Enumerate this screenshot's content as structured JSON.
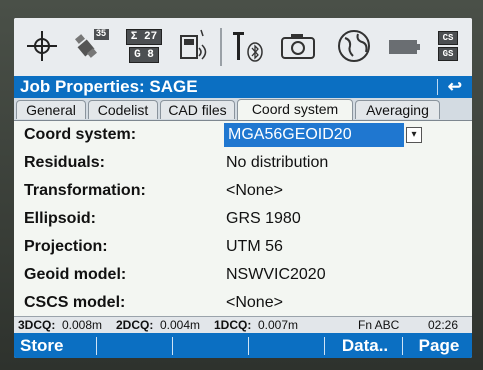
{
  "status": {
    "sat_counts": [
      "Σ 27",
      "G 8"
    ],
    "sat_badge": "35",
    "storage_top": "CS",
    "storage_bottom": "GS"
  },
  "title": "Job Properties: SAGE",
  "back_symbol": "↩",
  "tabs": [
    {
      "label": "General"
    },
    {
      "label": "Codelist"
    },
    {
      "label": "CAD files"
    },
    {
      "label": "Coord system"
    },
    {
      "label": "Averaging"
    }
  ],
  "fields": [
    {
      "label": "Coord system:",
      "value": "MGA56GEOID20"
    },
    {
      "label": "Residuals:",
      "value": "No distribution"
    },
    {
      "label": "Transformation:",
      "value": "<None>"
    },
    {
      "label": "Ellipsoid:",
      "value": "GRS 1980"
    },
    {
      "label": "Projection:",
      "value": "UTM 56"
    },
    {
      "label": "Geoid model:",
      "value": "NSWVIC2020"
    },
    {
      "label": "CSCS model:",
      "value": "<None>"
    }
  ],
  "info": {
    "q3d_label": "3DCQ:",
    "q3d_value": "0.008m",
    "q2d_label": "2DCQ:",
    "q2d_value": "0.004m",
    "q1d_label": "1DCQ:",
    "q1d_value": "0.007m",
    "mode": "Fn ABC",
    "time": "02:26"
  },
  "softkeys": {
    "store": "Store",
    "data": "Data..",
    "page": "Page"
  },
  "colors": {
    "accent": "#0b6fc2",
    "selection": "#1f77d0"
  }
}
